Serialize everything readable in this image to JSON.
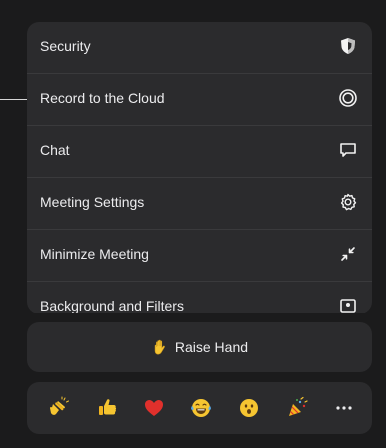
{
  "menu": {
    "items": [
      {
        "label": "Security",
        "icon": "shield-icon"
      },
      {
        "label": "Record to the Cloud",
        "icon": "record-icon"
      },
      {
        "label": "Chat",
        "icon": "chat-bubble-icon"
      },
      {
        "label": "Meeting Settings",
        "icon": "gear-icon"
      },
      {
        "label": "Minimize Meeting",
        "icon": "minimize-icon"
      },
      {
        "label": "Background and Filters",
        "icon": "background-icon"
      }
    ]
  },
  "raise_hand": {
    "label": "Raise Hand",
    "icon": "raised-hand-icon"
  },
  "reactions": {
    "items": [
      {
        "icon": "clapping-hands-icon"
      },
      {
        "icon": "thumbs-up-icon"
      },
      {
        "icon": "red-heart-icon"
      },
      {
        "icon": "tears-of-joy-icon"
      },
      {
        "icon": "surprised-face-icon"
      },
      {
        "icon": "party-popper-icon"
      },
      {
        "icon": "more-icon"
      }
    ]
  },
  "colors": {
    "background": "#1b1b1c",
    "card": "#2b2b2d",
    "text": "#ececee"
  }
}
